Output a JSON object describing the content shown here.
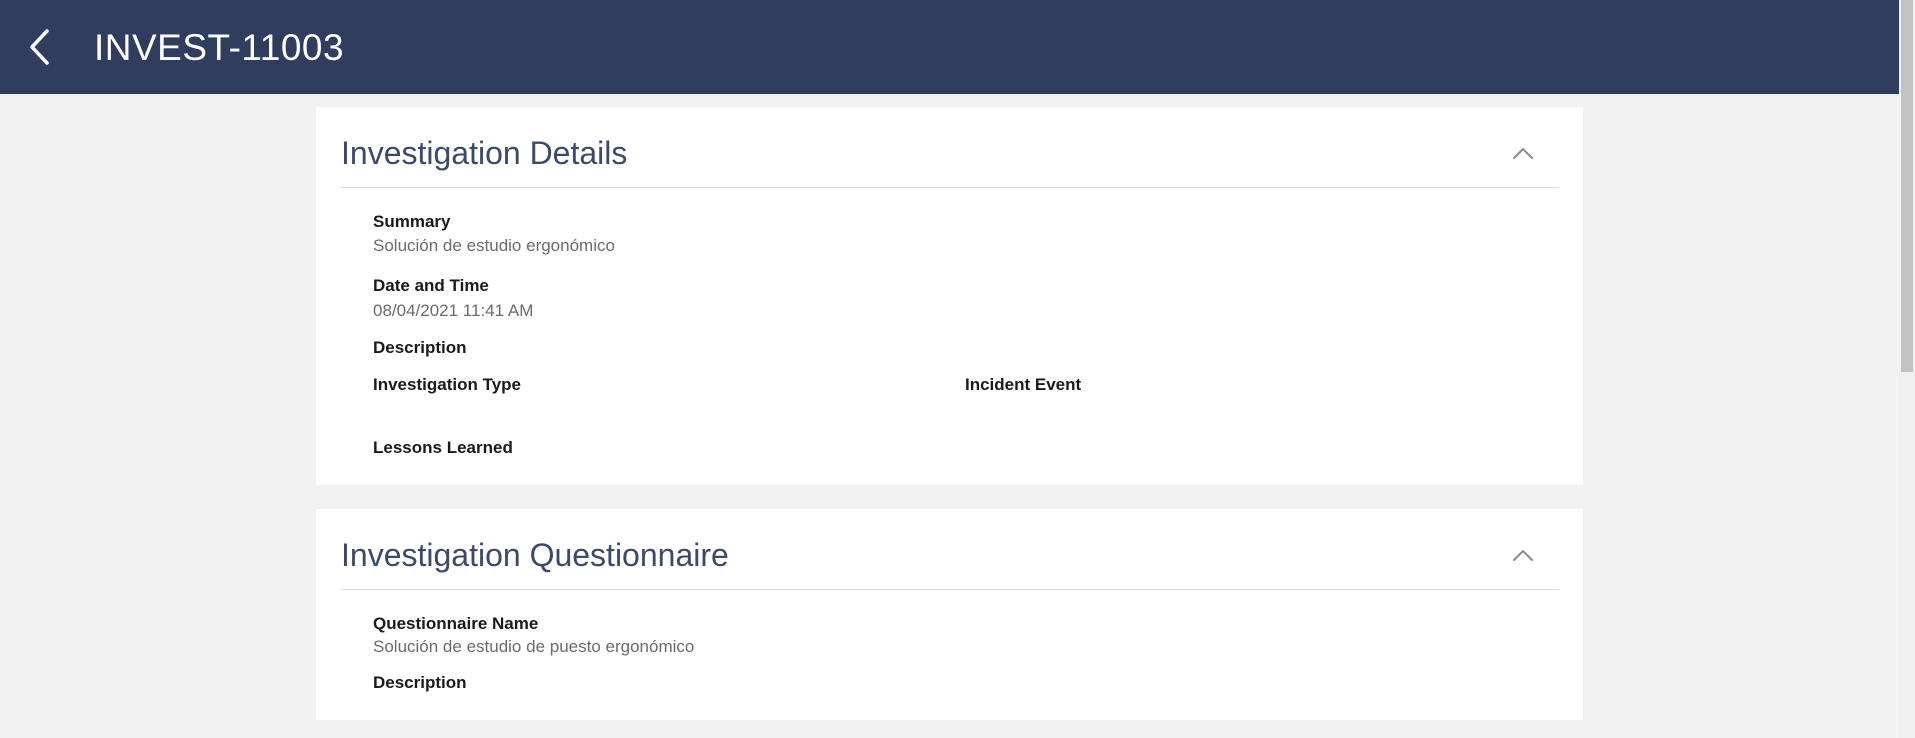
{
  "header": {
    "title": "INVEST-11003",
    "back_icon": "chevron-left-icon",
    "background": "#2f3d5e"
  },
  "investigation_details": {
    "title": "Investigation Details",
    "collapse_icon": "chevron-up-icon",
    "summary_label": "Summary",
    "summary_value": "Solución de estudio ergonómico",
    "date_label": "Date and Time",
    "date_value": "08/04/2021 11:41 AM",
    "description_label": "Description",
    "investigation_type_label": "Investigation Type",
    "incident_event_label": "Incident Event",
    "lessons_learned_label": "Lessons Learned"
  },
  "investigation_questionnaire": {
    "title": "Investigation Questionnaire",
    "collapse_icon": "chevron-up-icon",
    "questionnaire_name_label": "Questionnaire Name",
    "questionnaire_name_value": "Solución de estudio de puesto ergonómico",
    "description_label": "Description"
  }
}
